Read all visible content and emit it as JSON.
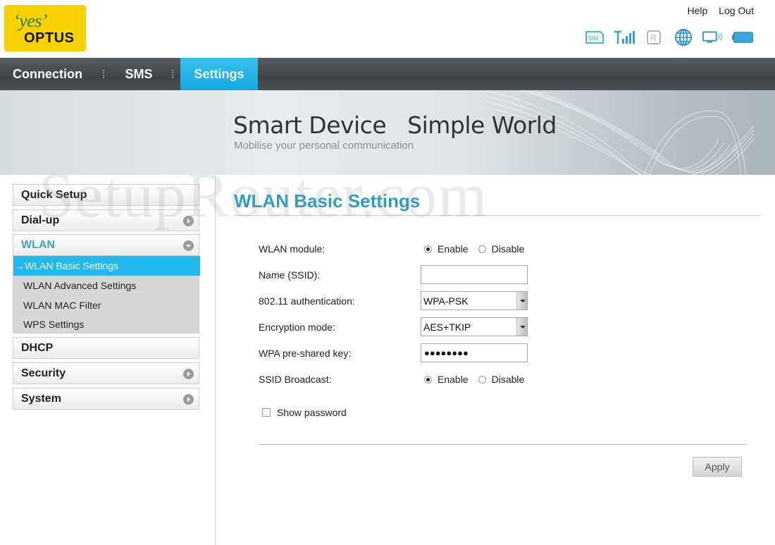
{
  "brand": {
    "logo_top": "‘yes’",
    "logo_bottom": "OPTUS"
  },
  "top_links": {
    "help": "Help",
    "logout": "Log Out"
  },
  "status_icons": [
    "sim-icon",
    "signal-strength-icon",
    "roaming-icon",
    "internet-globe-icon",
    "wifi-device-icon",
    "battery-icon"
  ],
  "nav": {
    "tabs": [
      {
        "label": "Connection",
        "active": false
      },
      {
        "label": "SMS",
        "active": false
      },
      {
        "label": "Settings",
        "active": true
      }
    ]
  },
  "banner": {
    "headline": "Smart Device   Simple World",
    "tagline": "Mobilise your personal communication"
  },
  "watermark": "SetupRouter.com",
  "sidebar": {
    "items": [
      {
        "label": "Quick Setup",
        "has_arrow": false
      },
      {
        "label": "Dial-up",
        "has_arrow": true
      },
      {
        "label": "WLAN",
        "has_arrow": true,
        "expanded": true
      },
      {
        "label": "DHCP",
        "has_arrow": false
      },
      {
        "label": "Security",
        "has_arrow": true
      },
      {
        "label": "System",
        "has_arrow": true
      }
    ],
    "wlan_subitems": [
      {
        "label": "→WLAN Basic Settings",
        "active": true
      },
      {
        "label": "WLAN Advanced Settings",
        "active": false
      },
      {
        "label": "WLAN MAC Filter",
        "active": false
      },
      {
        "label": "WPS Settings",
        "active": false
      }
    ]
  },
  "main": {
    "title": "WLAN Basic Settings",
    "fields": {
      "wlan_module": {
        "label": "WLAN module:",
        "options": [
          "Enable",
          "Disable"
        ],
        "selected": "Enable"
      },
      "ssid": {
        "label": "Name (SSID):",
        "value": ""
      },
      "auth": {
        "label": "802.11 authentication:",
        "value": "WPA-PSK"
      },
      "encryption": {
        "label": "Encryption mode:",
        "value": "AES+TKIP"
      },
      "psk": {
        "label": "WPA pre-shared key:",
        "value": "●●●●●●●●"
      },
      "ssid_broadcast": {
        "label": "SSID Broadcast:",
        "options": [
          "Enable",
          "Disable"
        ],
        "selected": "Enable"
      }
    },
    "show_password": {
      "label": "Show password",
      "checked": false
    },
    "apply_label": "Apply"
  },
  "colors": {
    "accent_blue": "#22b8ec",
    "title_blue": "#2c9cc5",
    "logo_yellow": "#f7d100",
    "nav_dark": "#43484b"
  }
}
